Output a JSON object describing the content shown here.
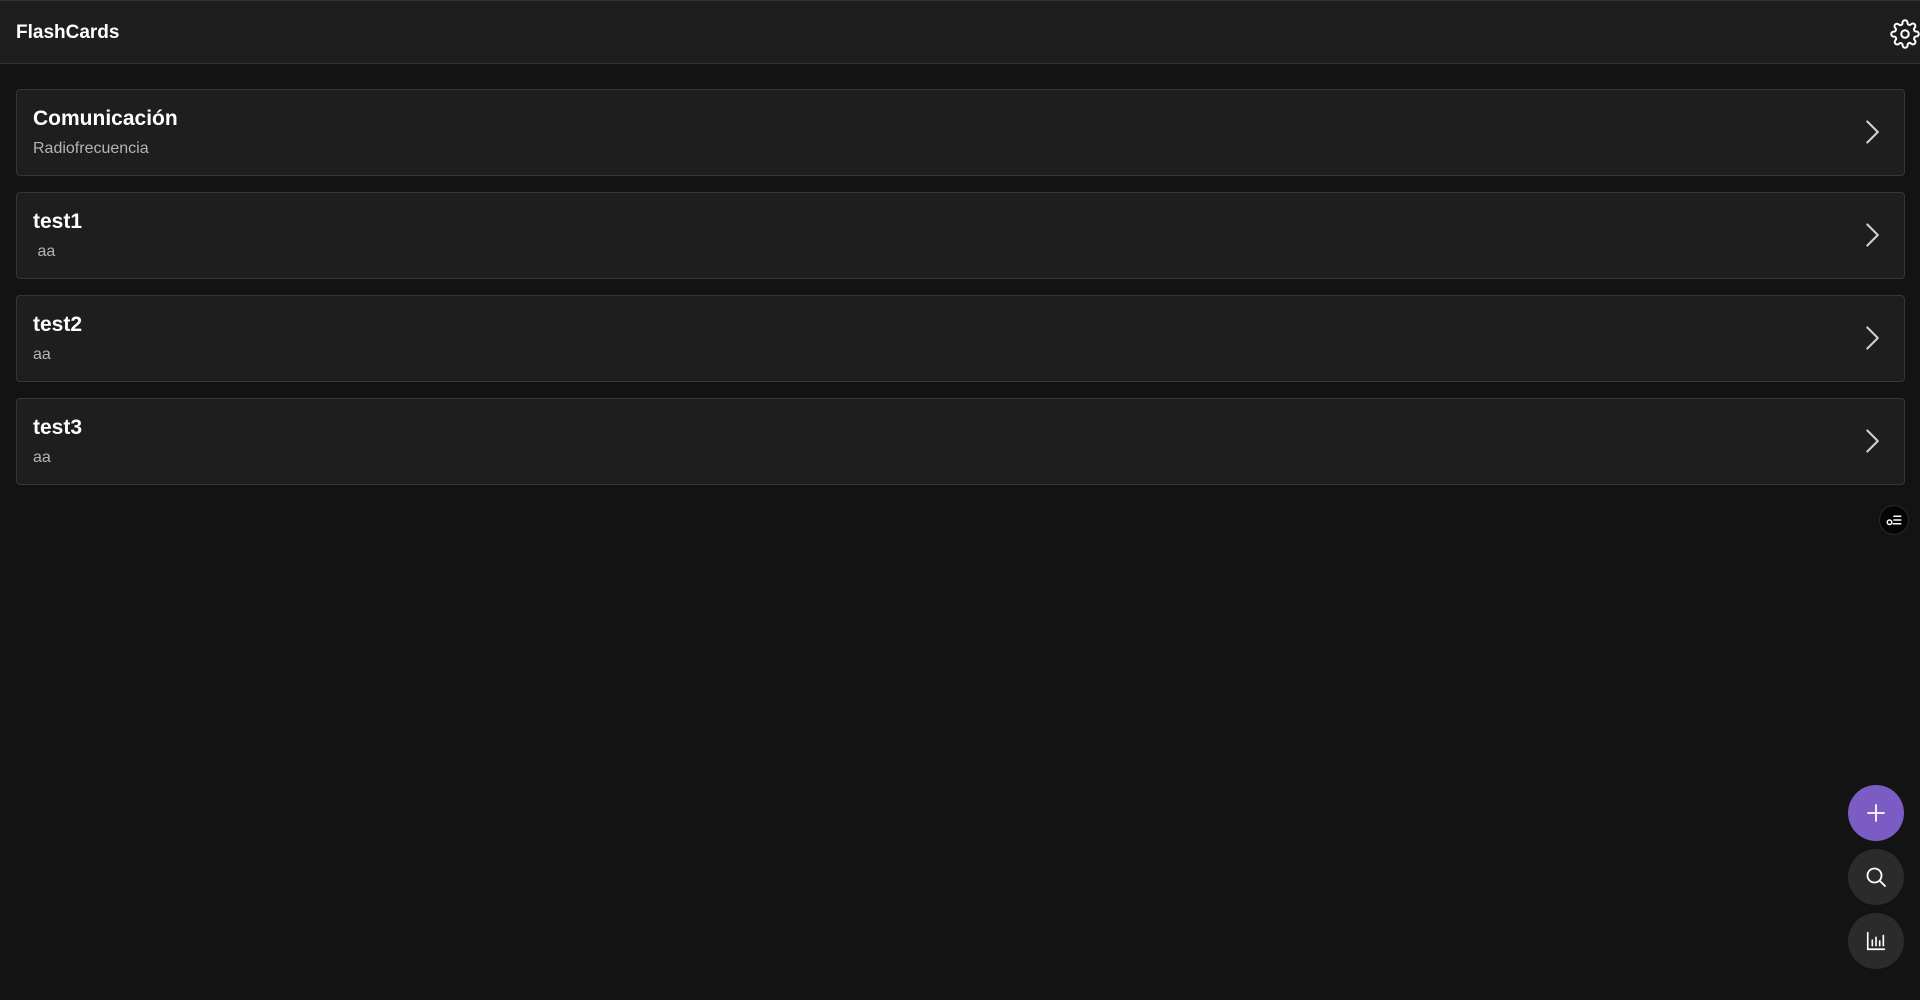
{
  "header": {
    "title": "FlashCards",
    "settings_icon": "gear-icon"
  },
  "decks": [
    {
      "title": "Comunicación",
      "subtitle": "Radiofrecuencia"
    },
    {
      "title": "test1",
      "subtitle": " aa"
    },
    {
      "title": "test2",
      "subtitle": "aa"
    },
    {
      "title": "test3",
      "subtitle": "aa"
    }
  ],
  "icons": {
    "deck_chevron": "chevron-right-icon",
    "toggle": "list-filter-icon",
    "add": "plus-icon",
    "search": "search-icon",
    "stats": "bar-chart-icon"
  },
  "colors": {
    "background": "#131313",
    "surface": "#1e1e1e",
    "accent": "#7b5cc4",
    "fab_secondary": "#2b2b2b"
  }
}
